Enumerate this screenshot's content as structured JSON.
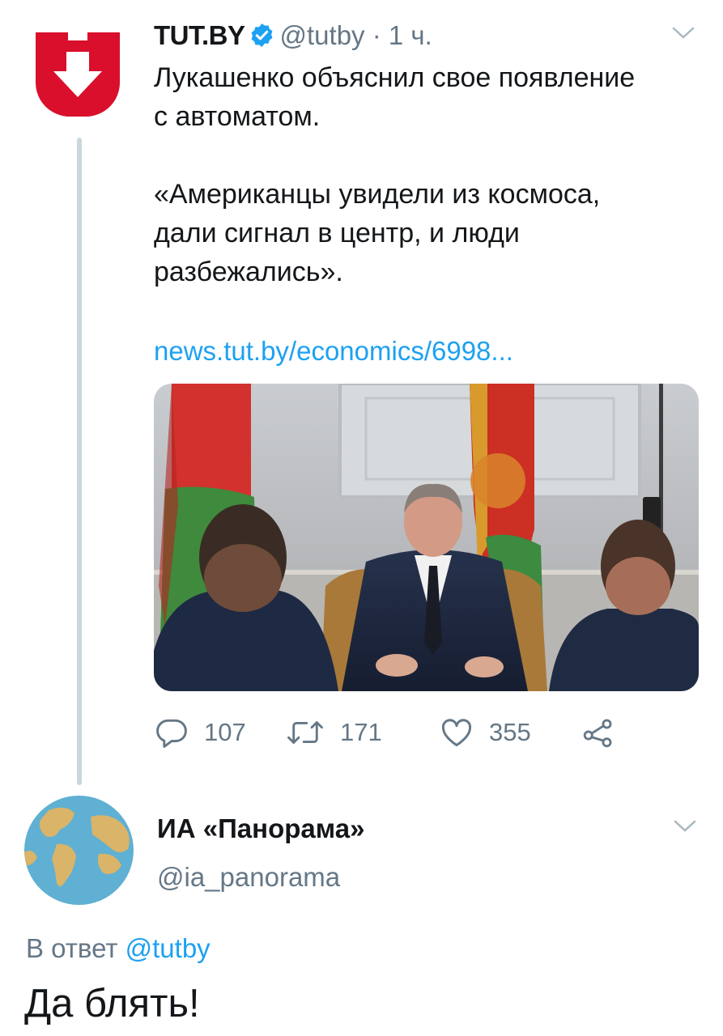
{
  "tweet": {
    "author_name": "TUT.BY",
    "author_handle": "@tutby",
    "separator": "·",
    "time": "1 ч.",
    "text_lines": [
      "Лукашенко объяснил свое появление\nс автоматом.",
      "«Американцы увидели из космоса,\nдали сигнал в центр, и люди\nразбежались»."
    ],
    "link": "news.tut.by/economics/6998...",
    "actions": {
      "replies": "107",
      "retweets": "171",
      "likes": "355"
    }
  },
  "reply": {
    "author_name": "ИА «Панорама»",
    "author_handle": "@ia_panorama",
    "reply_to_prefix": "В ответ",
    "reply_to_handle": "@tutby",
    "text": "Да блять!"
  },
  "colors": {
    "brand_red": "#d90f2c",
    "link_blue": "#1da1f2",
    "muted_gray": "#657786",
    "thread_line": "#ccd6dd"
  }
}
